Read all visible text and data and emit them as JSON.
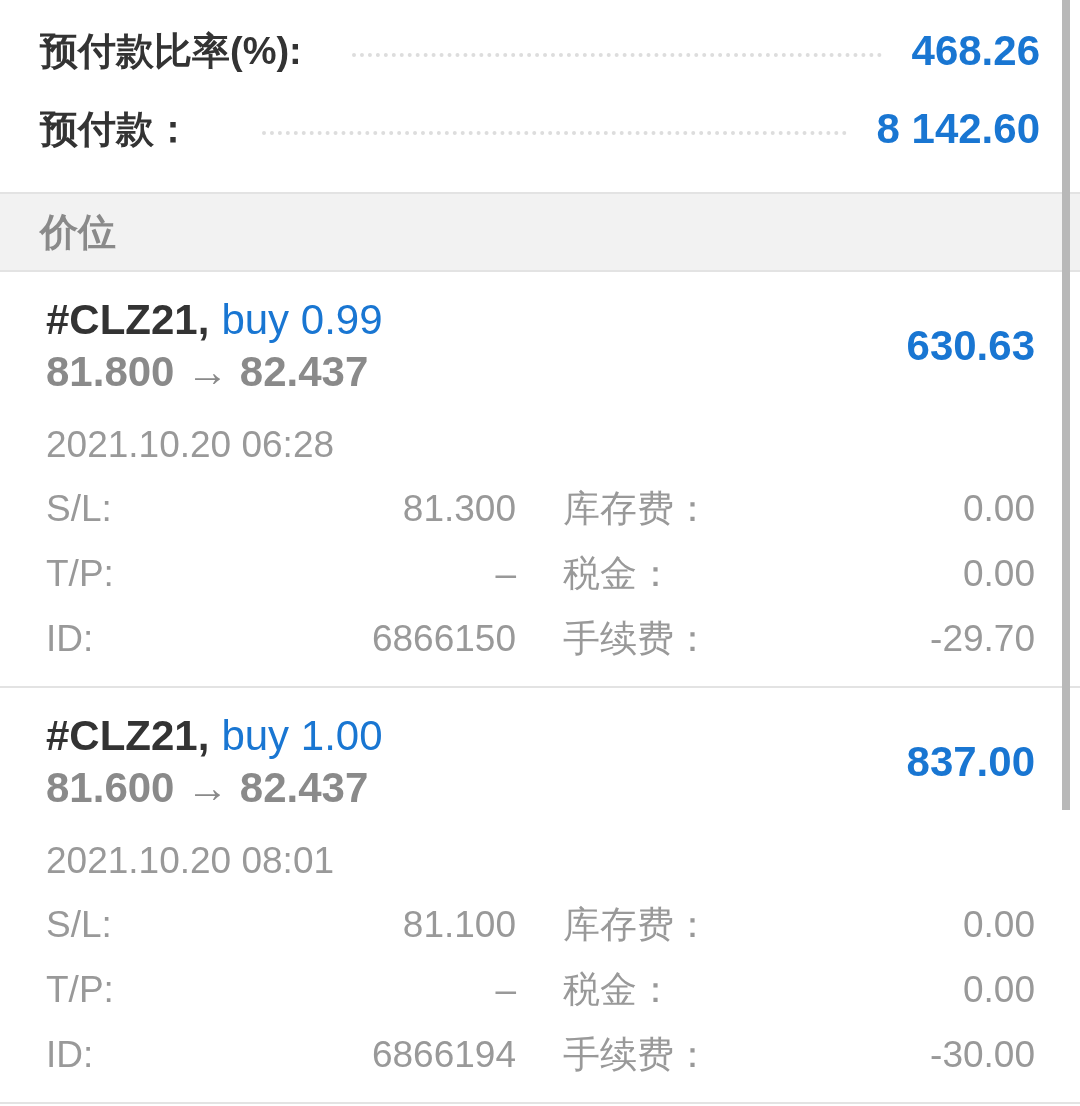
{
  "account": [
    {
      "label": "预付款比率(%):",
      "value": "468.26"
    },
    {
      "label": "预付款：",
      "value": "8 142.60"
    }
  ],
  "section": {
    "title": "价位"
  },
  "positions": [
    {
      "symbol": "#CLZ21,",
      "order": "buy 0.99",
      "prices": "81.800 → 82.437",
      "profit": "630.63",
      "time": "2021.10.20 06:28",
      "details": [
        {
          "label": "S/L:",
          "value": "81.300",
          "label_2": "库存费：",
          "value_2": "0.00"
        },
        {
          "label": "T/P:",
          "value": "–",
          "label_2": "税金：",
          "value_2": "0.00"
        },
        {
          "label": "ID:",
          "value": "6866150",
          "label_2": "手续费：",
          "value_2": "-29.70"
        }
      ]
    },
    {
      "symbol": "#CLZ21,",
      "order": "buy 1.00",
      "prices": "81.600 → 82.437",
      "profit": "837.00",
      "time": "2021.10.20 08:01",
      "details": [
        {
          "label": "S/L:",
          "value": "81.100",
          "label_2": "库存费：",
          "value_2": "0.00"
        },
        {
          "label": "T/P:",
          "value": "–",
          "label_2": "税金：",
          "value_2": "0.00"
        },
        {
          "label": "ID:",
          "value": "6866194",
          "label_2": "手续费：",
          "value_2": "-30.00"
        }
      ]
    }
  ]
}
